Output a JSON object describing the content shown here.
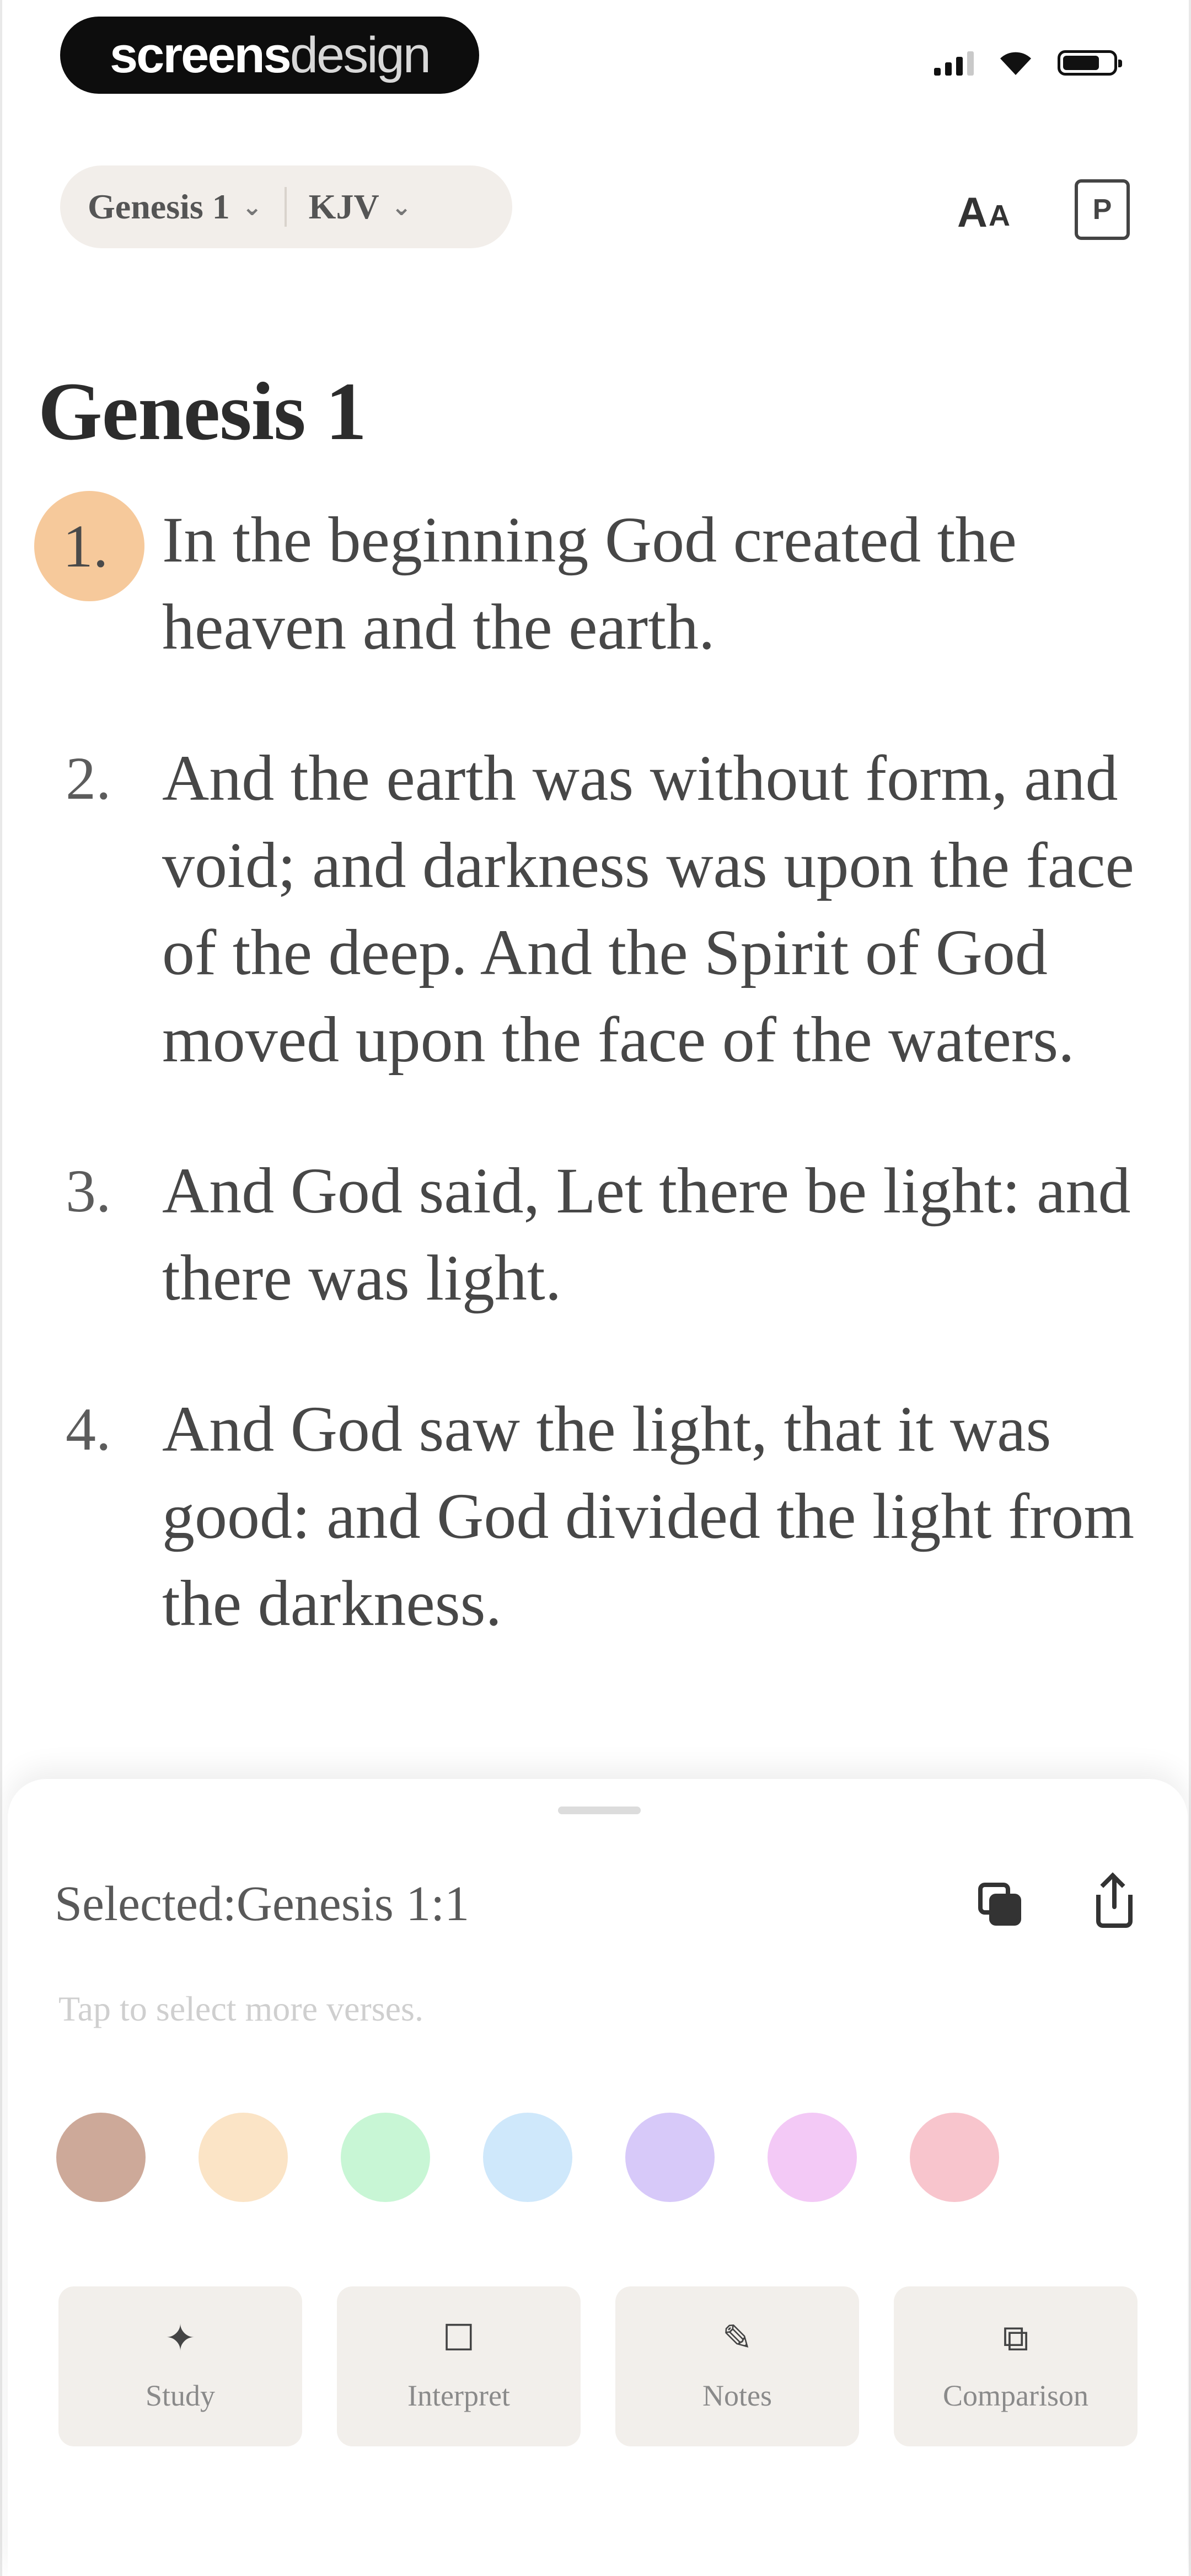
{
  "status_bar": {
    "brand_bold": "screens",
    "brand_light": "design",
    "icons": [
      "signal-icon",
      "wifi-icon",
      "battery-icon"
    ]
  },
  "nav": {
    "book_selector": "Genesis 1",
    "version_selector": "KJV",
    "font_size_big": "A",
    "font_size_small": "A",
    "bookmark_glyph": "P"
  },
  "chapter": {
    "title": "Genesis 1",
    "verses": [
      {
        "number": "1.",
        "text": "In the beginning God created the heaven and the earth.",
        "selected": true
      },
      {
        "number": "2.",
        "text": "And the earth was without form, and void; and darkness was upon the face of the deep. And the Spirit of God moved upon the face of the waters.",
        "selected": false
      },
      {
        "number": "3.",
        "text": "And God said, Let there be light: and there was light.",
        "selected": false
      },
      {
        "number": "4.",
        "text": "And God saw the light, that it was good: and God divided the light from the darkness.",
        "selected": false
      }
    ]
  },
  "sheet": {
    "selected_label": "Selected:Genesis 1:1",
    "hint": "Tap to select more verses.",
    "highlight_colors": [
      "#cda999",
      "#fbe4c6",
      "#c8f6d5",
      "#cfe8fb",
      "#d7c9f9",
      "#f3c9f6",
      "#f8c5cd"
    ],
    "actions": [
      {
        "label": "Study",
        "icon": "sparkle-icon",
        "glyph": "✦"
      },
      {
        "label": "Interpret",
        "icon": "chat-icon",
        "glyph": "☐"
      },
      {
        "label": "Notes",
        "icon": "pencil-icon",
        "glyph": "✎"
      },
      {
        "label": "Comparison",
        "icon": "compare-icon",
        "glyph": "⧉"
      }
    ]
  }
}
